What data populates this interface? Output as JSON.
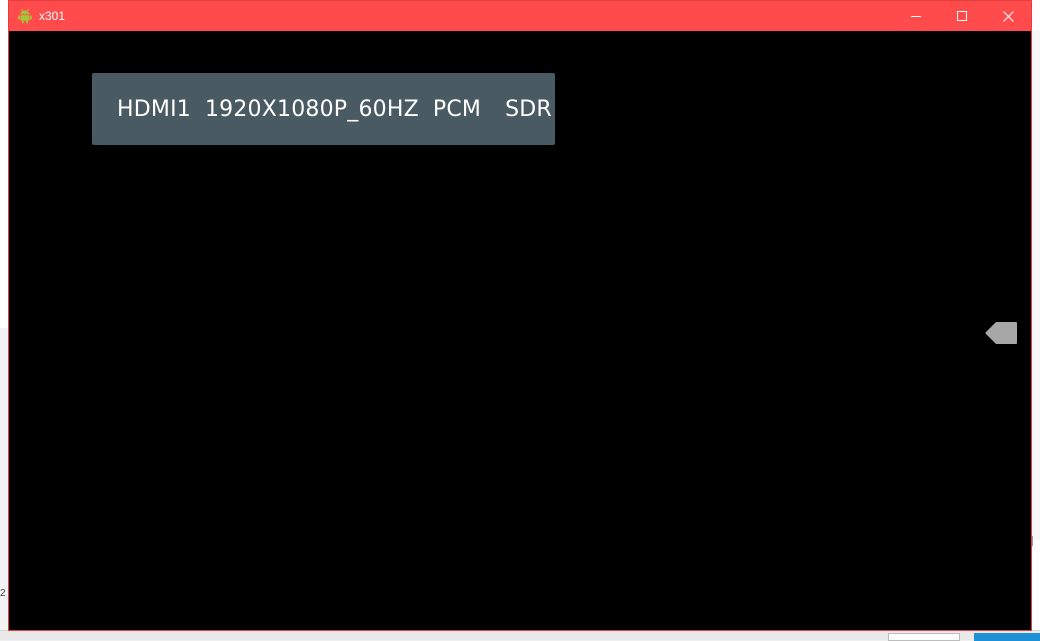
{
  "window": {
    "title": "x301",
    "title_bar_color": "#ff4b4b",
    "app_icon": "android-icon",
    "controls": {
      "minimize_icon": "minimize-icon",
      "maximize_icon": "maximize-icon",
      "close_icon": "close-icon"
    }
  },
  "overlay": {
    "source": "HDMI1",
    "resolution": "1920X1080P_60HZ",
    "audio": "PCM",
    "dynamic_range": "SDR",
    "background_color": "#4a5a62"
  },
  "side_tab": {
    "icon": "side-tab-arrow-icon",
    "color": "#a7a7a7"
  },
  "background": {
    "left_fragment_text": "2"
  }
}
